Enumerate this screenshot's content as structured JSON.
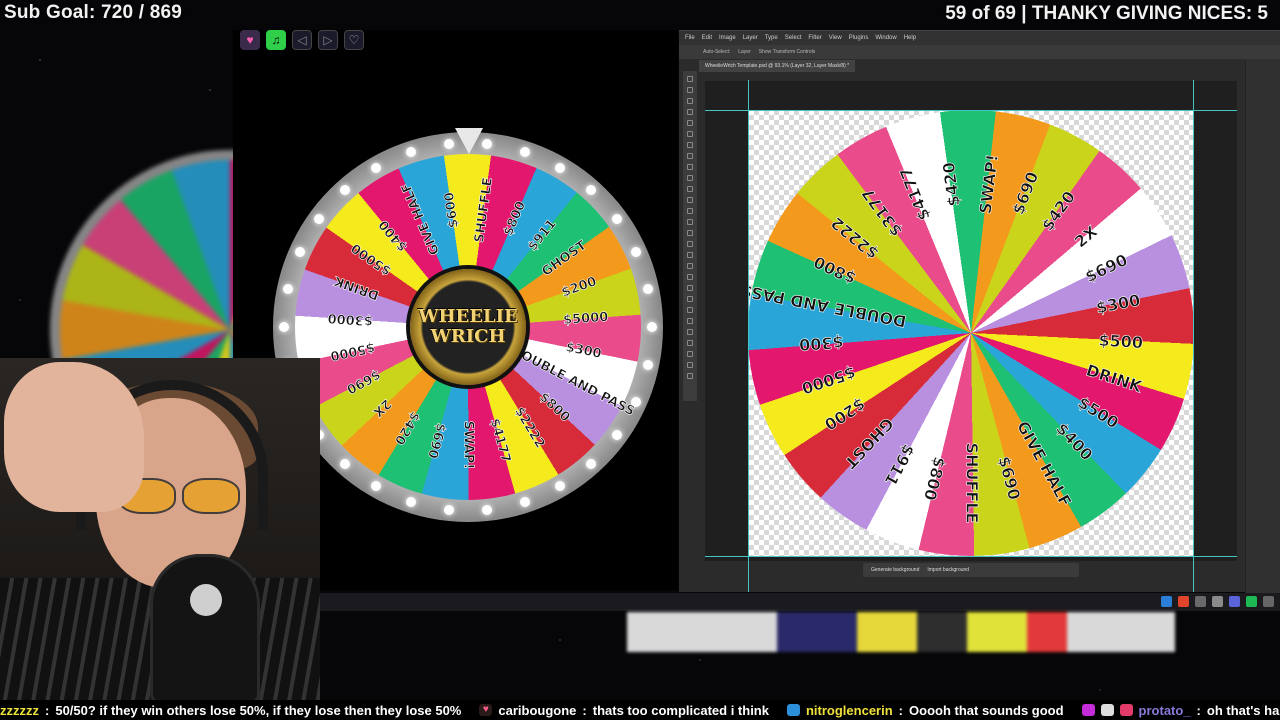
{
  "overlay": {
    "sub_goal": "Sub Goal: 720 / 869",
    "nices": "59 of 69 | THANKY GIVING NICES: 5"
  },
  "stream_deck_icons": [
    "heart-icon",
    "music-icon",
    "skip-back-icon",
    "skip-icon",
    "heart-outline-icon"
  ],
  "main_wheel": {
    "hub_line1": "WHEELIE",
    "hub_line2": "WRICH",
    "segment_labels": [
      "SHUFFLE",
      "$800",
      "$911",
      "GHOST",
      "$200",
      "$5000",
      "$300",
      "DOUBLE AND PASS",
      "$800",
      "$2222",
      "$4177",
      "SWAP!",
      "$690",
      "$420",
      "2X",
      "$690",
      "$5000",
      "$3000",
      "DRINK",
      "$5000",
      "$400",
      "GIVE HALF",
      "$600"
    ]
  },
  "photoshop": {
    "menu": [
      "File",
      "Edit",
      "Image",
      "Layer",
      "Type",
      "Select",
      "Filter",
      "View",
      "Plugins",
      "Window",
      "Help"
    ],
    "options": [
      "Auto-Select:",
      "Layer",
      "Show Transform Controls"
    ],
    "doc_tab": "WheelieWrich Template.psd @ 93.1% (Layer 32, Layer Mask/8) *",
    "context_bar": [
      "Generate background",
      "Import background"
    ],
    "wheel_labels": [
      "SWAP!",
      "$690",
      "$420",
      "2X",
      "$690",
      "$300",
      "$500",
      "DRINK",
      "$500",
      "$400",
      "GIVE HALF",
      "$690",
      "SHUFFLE",
      "$800",
      "$911",
      "GHOST",
      "$200",
      "$5000",
      "$300",
      "DOUBLE AND PASS",
      "$800",
      "$2222",
      "$3177",
      "$4177",
      "$420"
    ]
  },
  "chat": [
    {
      "name": "zzzzzz",
      "name_color": "#e9e33b",
      "message": "50/50? if they win others lose 50%, if they lose then they lose 50%"
    },
    {
      "name": "caribougone",
      "name_color": "#ffffff",
      "message": "thats too complicated i think"
    },
    {
      "name": "nitroglencerin",
      "name_color": "#f0e03c",
      "message": "Ooooh that sounds good"
    },
    {
      "name": "protato_",
      "name_color": "#8b78d8",
      "message": "oh that's hard"
    }
  ],
  "colors": {
    "pink": "#e3176d",
    "yellow": "#f4ea1c",
    "blue": "#2aa5d8",
    "green": "#1ec073",
    "orange": "#f39a1c",
    "lime": "#c9d41a",
    "ps_guide": "#46c4c4"
  }
}
